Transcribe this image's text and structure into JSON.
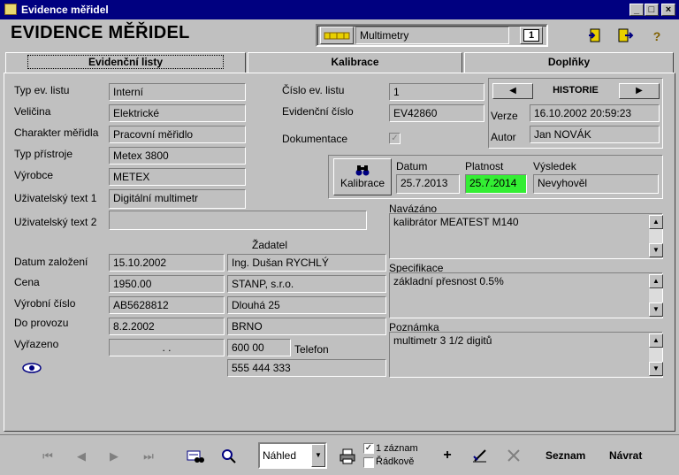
{
  "window": {
    "title": "Evidence měřidel"
  },
  "app": {
    "title": "EVIDENCE MĚŘIDEL",
    "category": "Multimetry",
    "record_badge": "1"
  },
  "tabs": [
    {
      "label": "Evidenční listy"
    },
    {
      "label": "Kalibrace"
    },
    {
      "label": "Doplňky"
    }
  ],
  "left_fields": [
    {
      "label": "Typ ev. listu",
      "value": "Interní"
    },
    {
      "label": "Veličina",
      "value": "Elektrické"
    },
    {
      "label": "Charakter měřidla",
      "value": "Pracovní měřidlo"
    },
    {
      "label": "Typ přístroje",
      "value": "Metex 3800"
    },
    {
      "label": "Výrobce",
      "value": "METEX"
    },
    {
      "label": "Uživatelský text 1",
      "value": "Digitální multimetr"
    },
    {
      "label": "Uživatelský text 2",
      "value": ""
    }
  ],
  "mid": {
    "cislo_label": "Číslo ev. listu",
    "cislo_value": "1",
    "evid_label": "Evidenční číslo",
    "evid_value": "EV42860",
    "dok_label": "Dokumentace",
    "dok_check": "✓"
  },
  "history": {
    "title": "HISTORIE",
    "verze_label": "Verze",
    "verze_value": "16.10.2002 20:59:23",
    "autor_label": "Autor",
    "autor_value": "Jan NOVÁK"
  },
  "calibration": {
    "button_label": "Kalibrace",
    "datum_label": "Datum",
    "datum_value": "25.7.2013",
    "platnost_label": "Platnost",
    "platnost_value": "25.7.2014",
    "vysledek_label": "Výsledek",
    "vysledek_value": "Nevyhověl",
    "platnost_color": "#33ee33"
  },
  "lower": {
    "zadatel_label": "Žadatel",
    "datum_zal_label": "Datum založení",
    "datum_zal_value": "15.10.2002",
    "cena_label": "Cena",
    "cena_value": "1950.00",
    "vyrobni_label": "Výrobní číslo",
    "vyrobni_value": "AB5628812",
    "provoz_label": "Do provozu",
    "provoz_value": "8.2.2002",
    "vyrazeno_label": "Vyřazeno",
    "vyrazeno_value": ". .",
    "zadatel_name": "Ing. Dušan RYCHLÝ",
    "zadatel_company": "STANP, s.r.o.",
    "zadatel_street": "Dlouhá 25",
    "zadatel_city": "BRNO",
    "zadatel_zip": "600 00",
    "telefon_label": "Telefon",
    "telefon_value": "555 444 333"
  },
  "notes": {
    "navazano_label": "Navázáno",
    "navazano_value": "kalibrátor MEATEST M140",
    "spec_label": "Specifikace",
    "spec_value": "základní přesnost 0.5%",
    "pozn_label": "Poznámka",
    "pozn_value": "multimetr 3 1/2 digitů"
  },
  "toolbar": {
    "view_select": "Náhled",
    "chk1_label": "1 záznam",
    "chk1_state": "✓",
    "chk2_label": "Řádkově",
    "seznam_label": "Seznam",
    "navrat_label": "Návrat"
  }
}
